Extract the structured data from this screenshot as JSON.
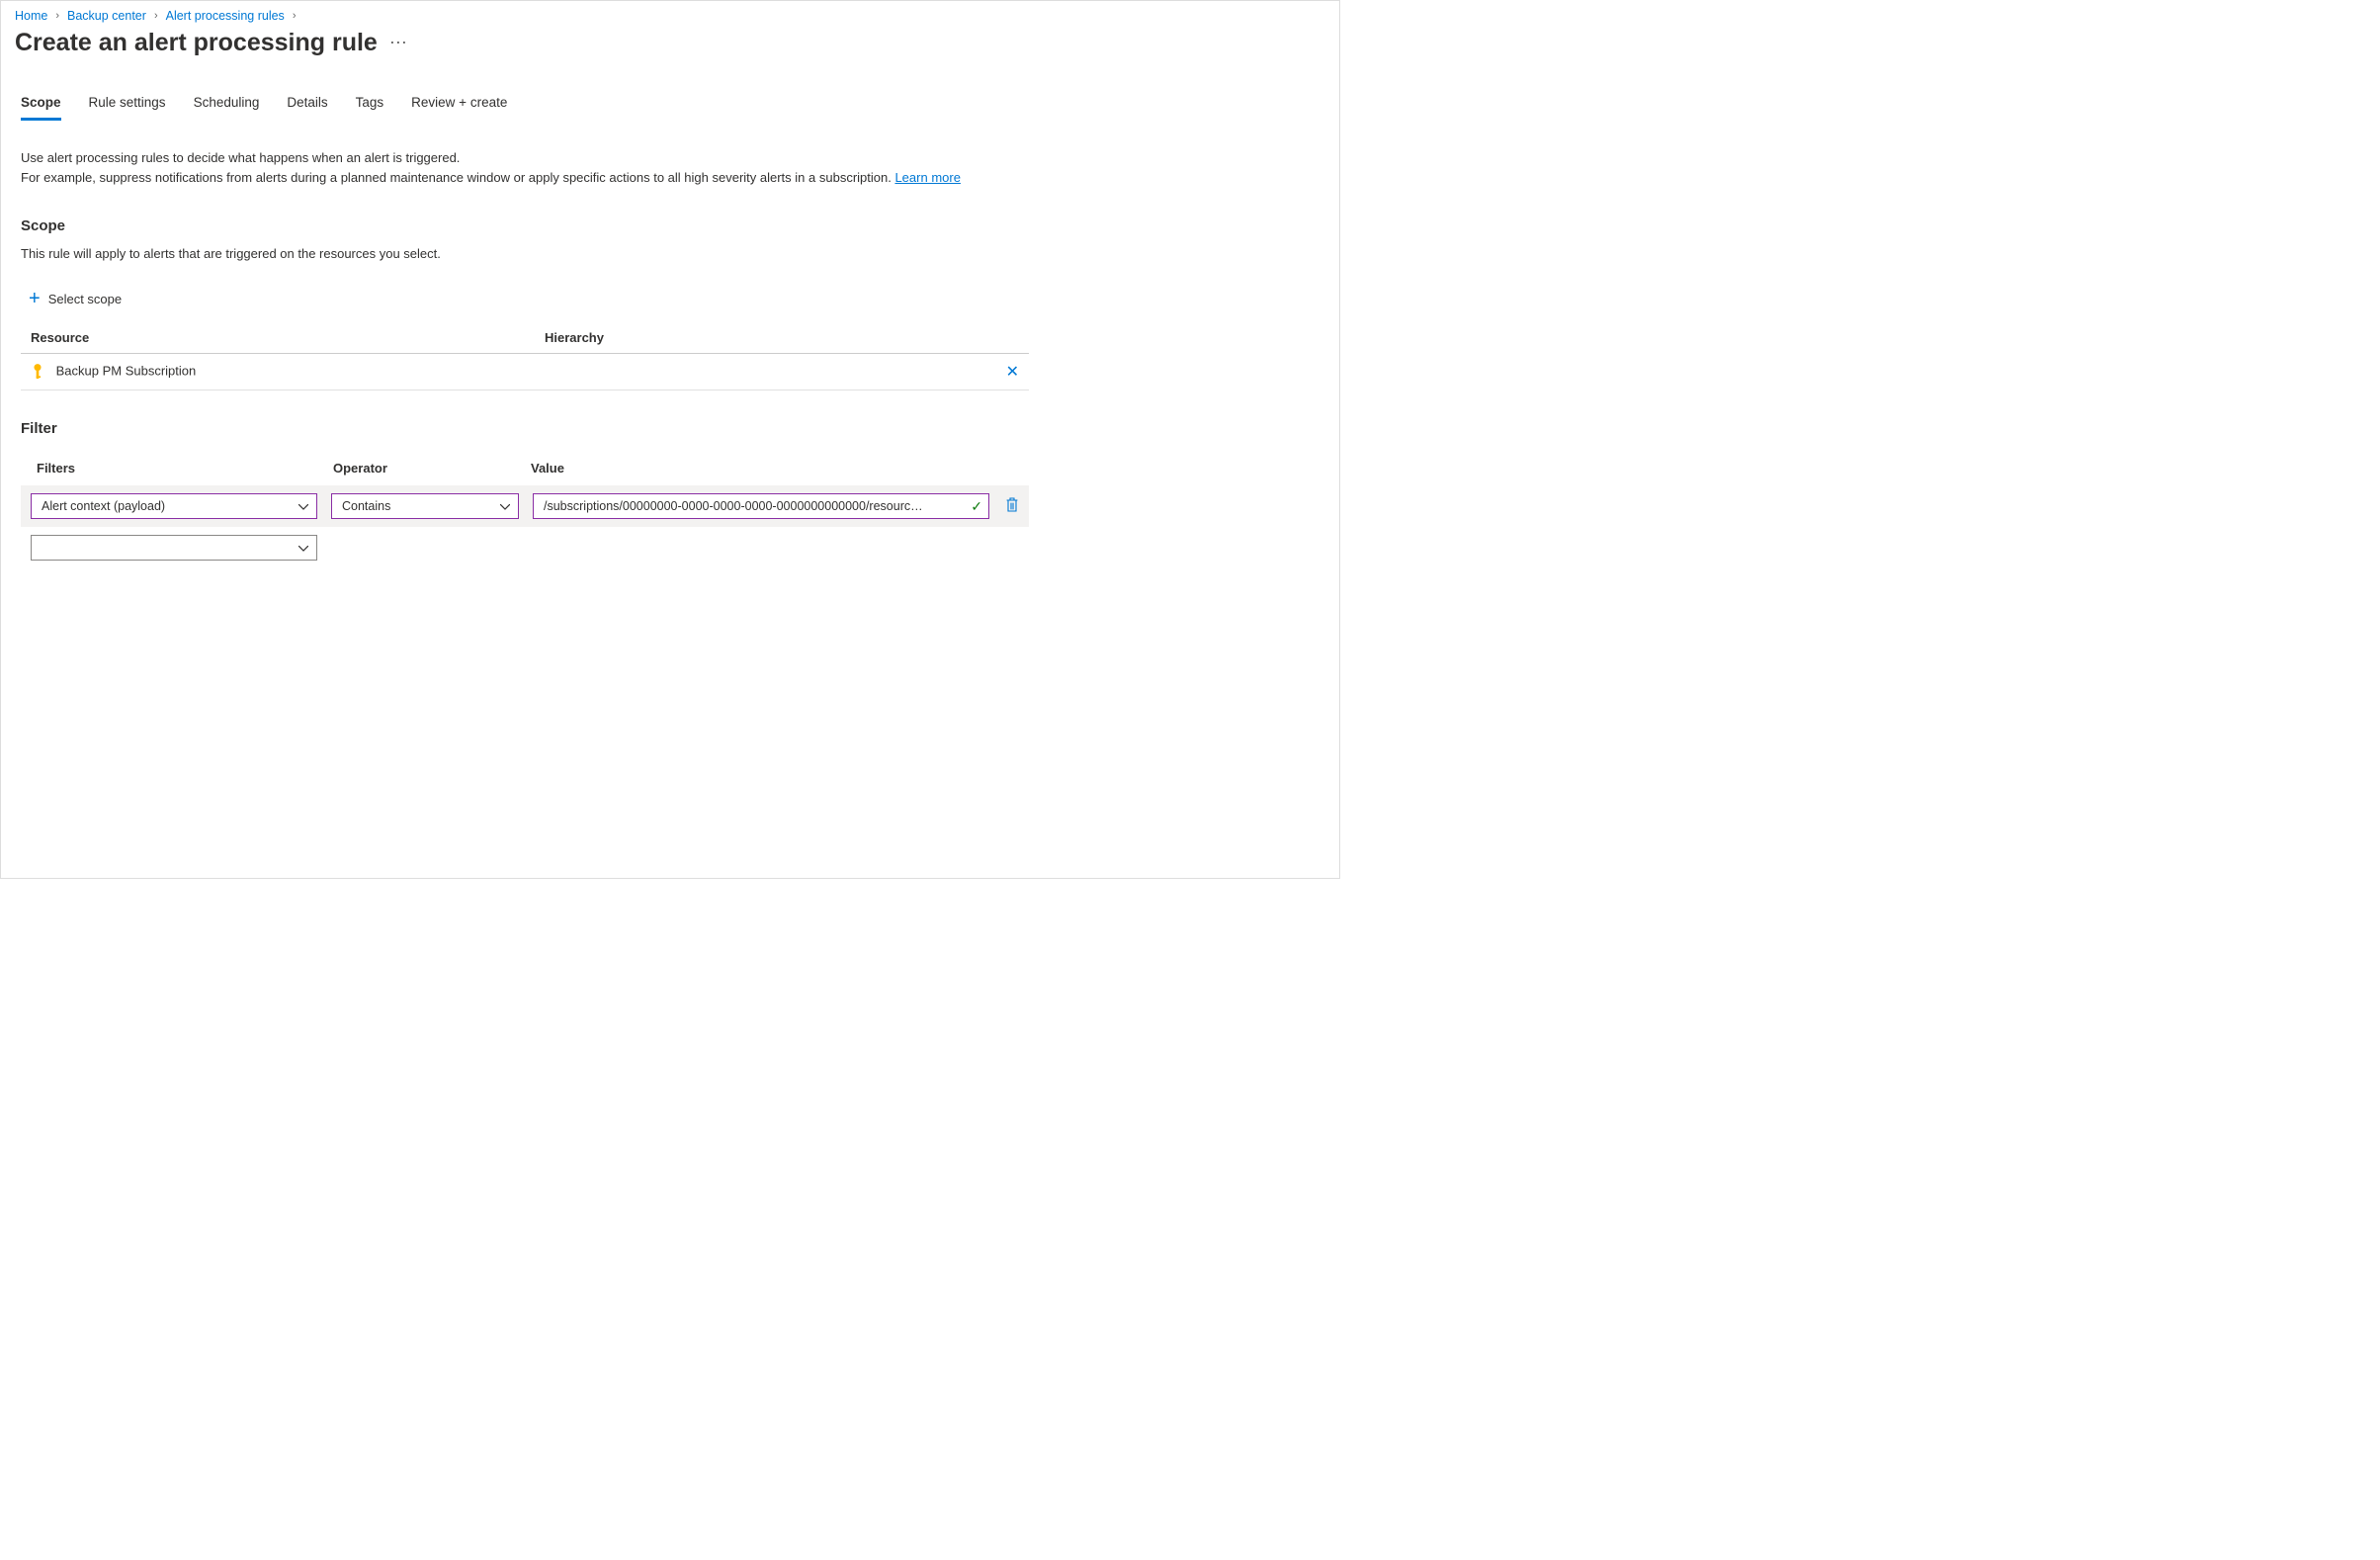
{
  "breadcrumb": [
    "Home",
    "Backup center",
    "Alert processing rules"
  ],
  "page_title": "Create an alert processing rule",
  "tabs": [
    "Scope",
    "Rule settings",
    "Scheduling",
    "Details",
    "Tags",
    "Review + create"
  ],
  "intro": {
    "line1": "Use alert processing rules to decide what happens when an alert is triggered.",
    "line2": "For example, suppress notifications from alerts during a planned maintenance window or apply specific actions to all high severity alerts in a subscription. ",
    "learn_more": "Learn more"
  },
  "scope": {
    "heading": "Scope",
    "desc": "This rule will apply to alerts that are triggered on the resources you select.",
    "select_label": "Select scope",
    "headers": {
      "resource": "Resource",
      "hierarchy": "Hierarchy"
    },
    "row": {
      "name": "Backup PM Subscription"
    }
  },
  "filter": {
    "heading": "Filter",
    "headers": {
      "filters": "Filters",
      "operator": "Operator",
      "value": "Value"
    },
    "row": {
      "filter": "Alert context (payload)",
      "operator": "Contains",
      "value": "/subscriptions/00000000-0000-0000-0000-0000000000000/resourc…"
    }
  }
}
